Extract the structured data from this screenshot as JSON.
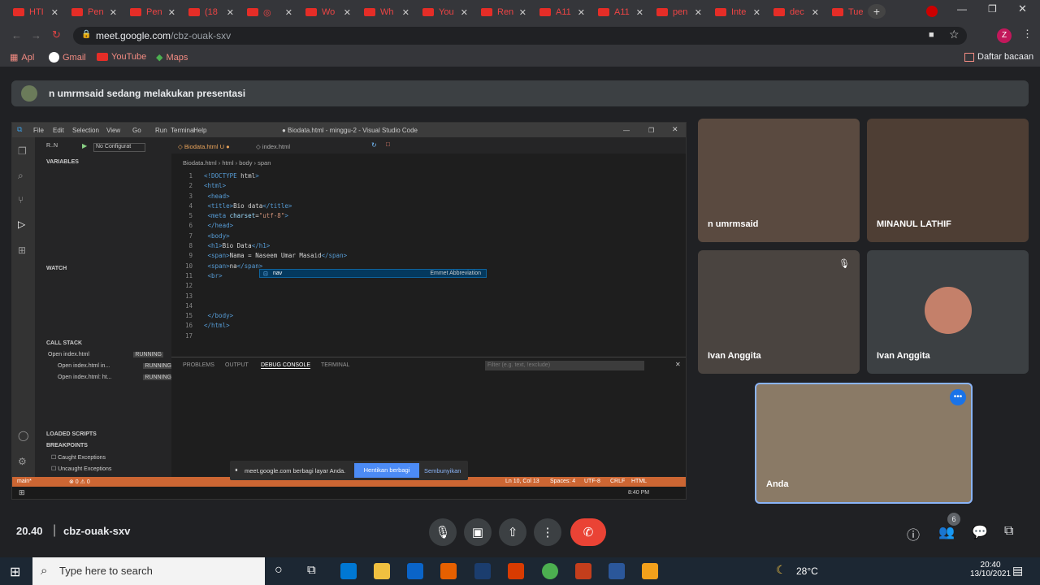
{
  "browser": {
    "tabs": [
      {
        "label": "HTI"
      },
      {
        "label": "Pen"
      },
      {
        "label": "Pen"
      },
      {
        "label": "(18"
      },
      {
        "label": "◎"
      },
      {
        "label": "Wo"
      },
      {
        "label": "Wh"
      },
      {
        "label": "You"
      },
      {
        "label": "Ren"
      },
      {
        "label": "A11"
      },
      {
        "label": "A11"
      },
      {
        "label": "pen"
      },
      {
        "label": "Inte"
      },
      {
        "label": "dec"
      },
      {
        "label": "Tue"
      }
    ],
    "url_domain": "meet.google.com",
    "url_path": "/cbz-ouak-sxv",
    "bookmarks": [
      "Apl",
      "Gmail",
      "YouTube",
      "Maps"
    ],
    "reading_list": "Daftar bacaan",
    "profile_initial": "Z"
  },
  "meet": {
    "presenting_banner": "n umrmsaid sedang melakukan presentasi",
    "time": "20.40",
    "meeting_code": "cbz-ouak-sxv",
    "participant_count": "6",
    "participants": [
      {
        "name": "n umrmsaid"
      },
      {
        "name": "MINANUL LATHIF"
      },
      {
        "name": "Ivan Anggita"
      },
      {
        "name": "Ivan Anggita"
      },
      {
        "name": "Anda"
      }
    ]
  },
  "vscode": {
    "title": "● Biodata.html - minggu-2 - Visual Studio Code",
    "menu": [
      "File",
      "Edit",
      "Selection",
      "View",
      "Go",
      "Run",
      "Terminal",
      "Help"
    ],
    "run_label": "R..N",
    "config": "No Configurat",
    "tabs": [
      {
        "label": "Biodata.html U"
      },
      {
        "label": "index.html"
      }
    ],
    "breadcrumb": "Biodata.html › html › body › span",
    "sections": {
      "variables": "VARIABLES",
      "watch": "WATCH",
      "callstack": "CALL STACK",
      "loaded": "LOADED SCRIPTS",
      "breakpoints": "BREAKPOINTS"
    },
    "callstack": [
      {
        "label": "Open index.html",
        "state": "RUNNING"
      },
      {
        "label": "Open index.html in...",
        "state": "RUNNING"
      },
      {
        "label": "Open index.html: ht...",
        "state": "RUNNING"
      }
    ],
    "breakpoints": [
      "Caught Exceptions",
      "Uncaught Exceptions"
    ],
    "code": [
      "<!DOCTYPE html>",
      "<html>",
      "    <head>",
      "        <title>Bio data</title>",
      "        <meta charset=\"utf-8\">",
      "    </head>",
      "    <body>",
      "    <h1>Bio Data</h1>",
      "    <span>Nama = Naseem Umar Masaid</span>",
      "    <span>na</span>",
      "    <br>",
      "",
      "",
      "",
      "    </body>",
      "</html>",
      ""
    ],
    "autocomplete": {
      "item": "nav",
      "detail": "Emmet Abbreviation"
    },
    "panel_tabs": [
      "PROBLEMS",
      "OUTPUT",
      "DEBUG CONSOLE",
      "TERMINAL"
    ],
    "filter_placeholder": "Filter (e.g. text, !exclude)",
    "status": {
      "branch": "main*",
      "errors": "⊗ 0 ⚠ 0",
      "pos": "Ln 10, Col 13",
      "spaces": "Spaces: 4",
      "enc": "UTF-8",
      "eol": "CRLF",
      "lang": "HTML"
    },
    "share_notice": "meet.google.com berbagi layar Anda.",
    "stop_share": "Hentikan berbagi",
    "hide": "Sembunyikan",
    "inner_clock": "8:40 PM"
  },
  "windows": {
    "search_placeholder": "Type here to search",
    "weather": "28°C",
    "time": "20:40",
    "date": "13/10/2021"
  }
}
